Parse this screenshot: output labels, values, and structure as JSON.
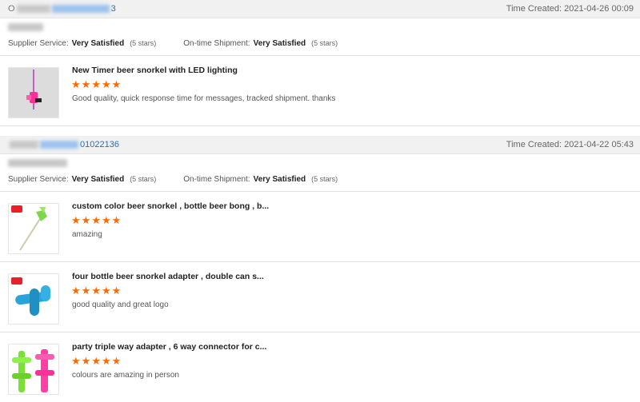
{
  "orders": [
    {
      "order_prefix": "O",
      "order_id_tail": "3",
      "time_created_label": "Time Created:",
      "time_created": "2021-04-26 00:09",
      "supplier_service_label": "Supplier Service:",
      "supplier_service_value": "Very Satisfied",
      "supplier_service_stars": "(5 stars)",
      "shipment_label": "On-time Shipment:",
      "shipment_value": "Very Satisfied",
      "shipment_stars": "(5 stars)",
      "products": [
        {
          "title": "New Timer beer snorkel with LED lighting",
          "rating": 5,
          "review": "Good quality, quick response time for messages, tracked shipment. thanks",
          "thumb_icon": "led-beer-snorkel-thumb"
        }
      ]
    },
    {
      "order_prefix": "",
      "order_id_tail": "01022136",
      "time_created_label": "Time Created:",
      "time_created": "2021-04-22 05:43",
      "supplier_service_label": "Supplier Service:",
      "supplier_service_value": "Very Satisfied",
      "supplier_service_stars": "(5 stars)",
      "shipment_label": "On-time Shipment:",
      "shipment_value": "Very Satisfied",
      "shipment_stars": "(5 stars)",
      "products": [
        {
          "title": "custom color beer snorkel , bottle beer bong , b...",
          "rating": 5,
          "review": "amazing",
          "thumb_icon": "green-beer-snorkel-thumb"
        },
        {
          "title": "four bottle beer snorkel adapter , double can s...",
          "rating": 5,
          "review": "good quality and great logo",
          "thumb_icon": "blue-snorkel-adapter-thumb"
        },
        {
          "title": "party triple way adapter , 6 way connector for c...",
          "rating": 5,
          "review": "colours are amazing in person",
          "thumb_icon": "triple-way-adapter-thumb"
        }
      ]
    }
  ],
  "colors": {
    "star": "#ff6a00",
    "link": "#1f6fc5",
    "header_bg": "#f1f1f1"
  }
}
